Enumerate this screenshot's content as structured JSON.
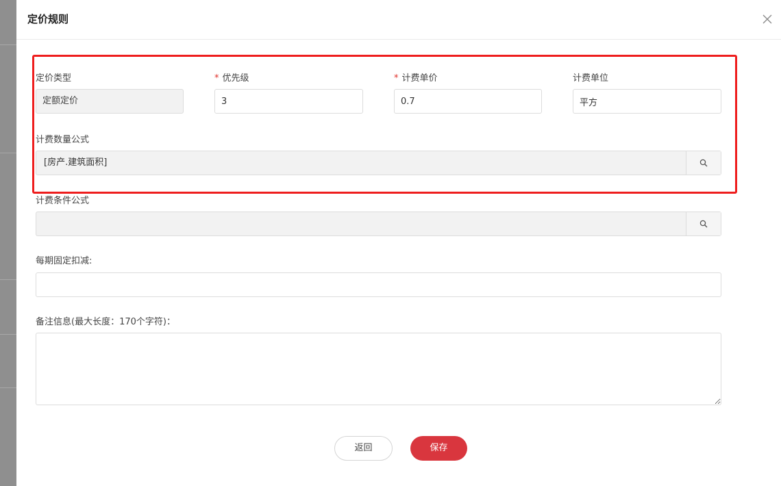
{
  "dialog": {
    "title": "定价规则"
  },
  "form": {
    "pricing_type": {
      "label": "定价类型",
      "value": "定额定价"
    },
    "priority": {
      "label": "优先级",
      "required_mark": "*",
      "value": "3"
    },
    "unit_price": {
      "label": "计费单价",
      "required_mark": "*",
      "value": "0.7"
    },
    "billing_unit": {
      "label": "计费单位",
      "value": "平方"
    },
    "quantity_formula": {
      "label": "计费数量公式",
      "value": "[房产.建筑面积]"
    },
    "condition_formula": {
      "label": "计费条件公式",
      "value": ""
    },
    "fixed_deduction": {
      "label": "每期固定扣减:",
      "value": ""
    },
    "remarks": {
      "label": "备注信息(最大长度：170个字符)：",
      "value": ""
    }
  },
  "actions": {
    "back_label": "返回",
    "save_label": "保存"
  },
  "colors": {
    "primary": "#d9363e",
    "highlight_box": "#ee1d1d",
    "required": "#e0312b"
  },
  "icons": {
    "close": "close-icon",
    "search": "search-icon"
  }
}
